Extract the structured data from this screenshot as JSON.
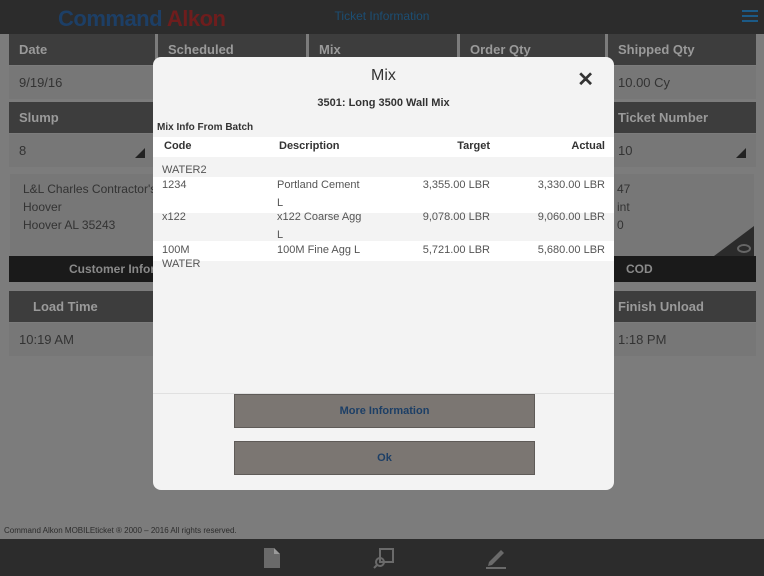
{
  "app": {
    "brand_part1": "Command",
    "brand_part2": "Alkon",
    "title": "Ticket Information"
  },
  "fields": {
    "date_label": "Date",
    "date_value": "9/19/16",
    "scheduled_label": "Scheduled",
    "mix_label": "Mix",
    "order_qty_label": "Order Qty",
    "shipped_qty_label": "Shipped Qty",
    "shipped_qty_value": "10.00 Cy",
    "slump_label": "Slump",
    "slump_value": "8",
    "ticket_number_label": "Ticket Number",
    "ticket_number_value": "10"
  },
  "customer": {
    "line1": "L&L Charles Contractor's",
    "line2": "Hoover",
    "line3": "Hoover AL 35243",
    "right1": "47",
    "right2": "int",
    "right3": "0",
    "bar_label": "Customer Infor",
    "cod_label": "COD"
  },
  "times": {
    "load_time_label": "Load Time",
    "load_time_value": "10:19 AM",
    "finish_unload_label": "Finish Unload",
    "finish_unload_value": "1:18 PM"
  },
  "footer": {
    "copyright": "Command Alkon MOBILEticket ® 2000 – 2016 All rights reserved."
  },
  "bottom_icons": [
    "document-icon",
    "search-ticket-icon",
    "sign-pen-icon"
  ],
  "modal": {
    "title": "Mix",
    "close": "✕",
    "subtitle": "3501: Long 3500 Wall Mix",
    "section": "Mix Info From Batch",
    "columns": {
      "code": "Code",
      "description": "Description",
      "target": "Target",
      "actual": "Actual"
    },
    "rows": [
      {
        "code": "WATER2",
        "description": "",
        "target": "",
        "actual": ""
      },
      {
        "code": "1234",
        "description": "Portland Cement",
        "desc2": "L",
        "target": "3,355.00 LBR",
        "actual": "3,330.00 LBR"
      },
      {
        "code": "x122",
        "description": "x122 Coarse Agg",
        "desc2": "L",
        "target": "9,078.00 LBR",
        "actual": "9,060.00 LBR"
      },
      {
        "code": "100M",
        "code2": "WATER",
        "description": "100M Fine Agg L",
        "target": "5,721.00 LBR",
        "actual": "5,680.00 LBR"
      }
    ],
    "more_info_button": "More Information",
    "ok_button": "Ok"
  }
}
